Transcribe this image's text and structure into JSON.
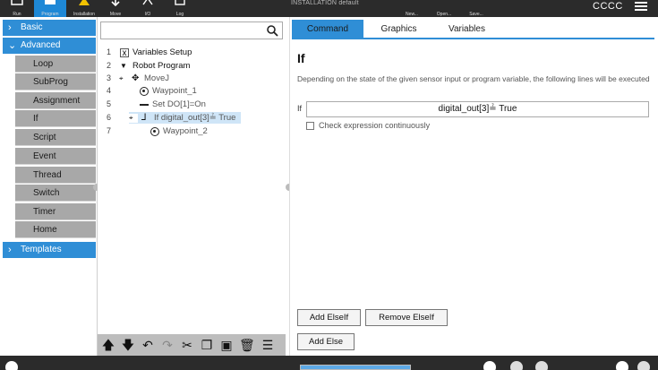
{
  "topbar": {
    "buttons": [
      {
        "label": "Run",
        "icon": "run-icon",
        "active": false
      },
      {
        "label": "Program",
        "icon": "program-icon",
        "active": true
      },
      {
        "label": "Installation",
        "icon": "installation-icon",
        "active": false
      },
      {
        "label": "Move",
        "icon": "move-icon",
        "active": false
      },
      {
        "label": "I/O",
        "icon": "io-icon",
        "active": false
      },
      {
        "label": "Log",
        "icon": "log-icon",
        "active": false
      }
    ],
    "installation_prefix": "INSTALLATION",
    "installation_name": "default",
    "file_buttons": [
      "New...",
      "Open...",
      "Save..."
    ],
    "user": "CCCC"
  },
  "left_panel": {
    "categories": [
      "Basic",
      "Advanced",
      "Templates"
    ],
    "advanced_items": [
      "Loop",
      "SubProg",
      "Assignment",
      "If",
      "Script",
      "Event",
      "Thread",
      "Switch",
      "Timer",
      "Home"
    ]
  },
  "tree": {
    "search_placeholder": "",
    "rows": [
      {
        "num": "1",
        "label": "Variables Setup",
        "icon": "variables-icon"
      },
      {
        "num": "2",
        "label": "Robot Program",
        "icon": "collapse-triangle-icon"
      },
      {
        "num": "3",
        "label": "MoveJ",
        "icon": "move-icon"
      },
      {
        "num": "4",
        "label": "Waypoint_1",
        "icon": "waypoint-icon"
      },
      {
        "num": "5",
        "label": "Set DO[1]=On",
        "icon": "set-icon"
      },
      {
        "num": "6",
        "label": "If digital_out[3]≟ True",
        "icon": "if-icon"
      },
      {
        "num": "7",
        "label": "Waypoint_2",
        "icon": "waypoint-icon"
      }
    ],
    "toolbar": [
      "move-up-icon",
      "move-down-icon",
      "undo-icon",
      "redo-icon",
      "cut-icon",
      "copy-icon",
      "paste-icon",
      "delete-icon",
      "suppress-icon"
    ]
  },
  "right_panel": {
    "tabs": [
      "Command",
      "Graphics",
      "Variables"
    ],
    "active_tab": "Command",
    "title": "If",
    "description": "Depending on the state of the given sensor input or program variable, the following lines will be executed",
    "if_label": "If",
    "expression": "digital_out[3]≟ True",
    "checkbox_label": "Check expression continuously",
    "checkbox_checked": false,
    "buttons": {
      "add_elseif": "Add ElseIf",
      "remove_elseif": "Remove ElseIf",
      "add_else": "Add Else"
    }
  },
  "colors": {
    "accent": "#2f8ed6",
    "topbar": "#2b2b2b",
    "submenu": "#a8a8a8"
  }
}
